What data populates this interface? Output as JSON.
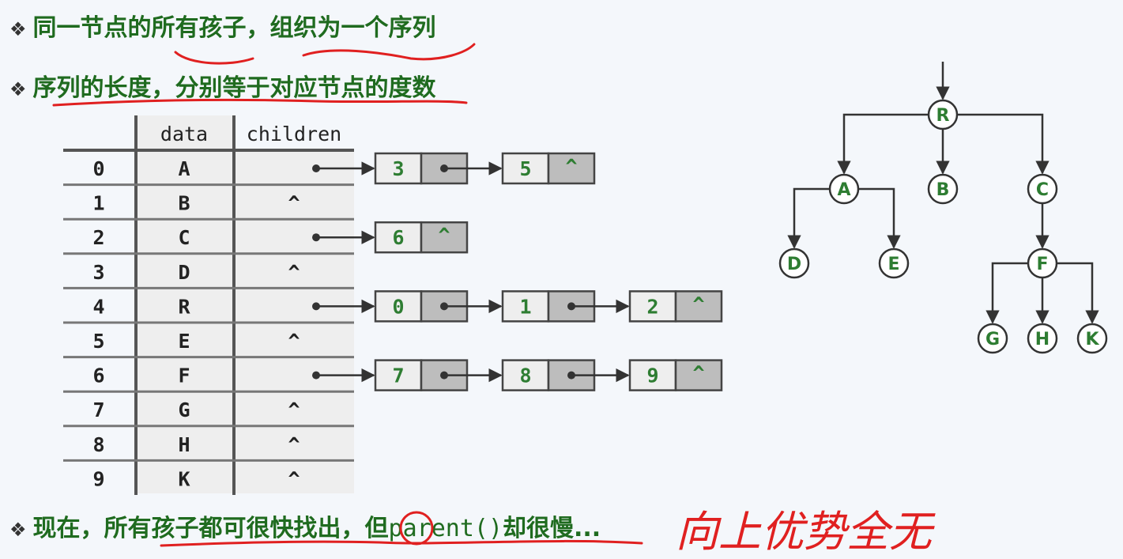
{
  "bullets": {
    "mark": "❖",
    "line1": "同一节点的所有孩子，组织为一个序列",
    "line2": "序列的长度，分别等于对应节点的度数",
    "line3_text": "现在，所有孩子都可很快找出，但",
    "line3_code": "parent()",
    "line3_tail": "却很慢..."
  },
  "table": {
    "headers": {
      "data": "data",
      "children": "children"
    },
    "rows": [
      {
        "index": "0",
        "data": "A",
        "children": []
      },
      {
        "index": "1",
        "data": "B",
        "children": "^"
      },
      {
        "index": "2",
        "data": "C",
        "children": []
      },
      {
        "index": "3",
        "data": "D",
        "children": "^"
      },
      {
        "index": "4",
        "data": "R",
        "children": []
      },
      {
        "index": "5",
        "data": "E",
        "children": "^"
      },
      {
        "index": "6",
        "data": "F",
        "children": []
      },
      {
        "index": "7",
        "data": "G",
        "children": "^"
      },
      {
        "index": "8",
        "data": "H",
        "children": "^"
      },
      {
        "index": "9",
        "data": "K",
        "children": "^"
      }
    ],
    "null_symbol": "^"
  },
  "child_lists": [
    {
      "row": "0",
      "values": [
        "3",
        "5"
      ]
    },
    {
      "row": "2",
      "values": [
        "6"
      ]
    },
    {
      "row": "4",
      "values": [
        "0",
        "1",
        "2"
      ]
    },
    {
      "row": "6",
      "values": [
        "7",
        "8",
        "9"
      ]
    }
  ],
  "tree": {
    "nodes": [
      "R",
      "A",
      "B",
      "C",
      "D",
      "E",
      "F",
      "G",
      "H",
      "K"
    ],
    "edges": [
      [
        "R",
        "A"
      ],
      [
        "R",
        "B"
      ],
      [
        "R",
        "C"
      ],
      [
        "A",
        "D"
      ],
      [
        "A",
        "E"
      ],
      [
        "C",
        "F"
      ],
      [
        "F",
        "G"
      ],
      [
        "F",
        "H"
      ],
      [
        "F",
        "K"
      ]
    ]
  },
  "handwritten_note": "向上优势全无",
  "colors": {
    "green": "#2e7d32",
    "red": "#e02020",
    "cell_light": "#eeeeee",
    "cell_dark": "#bdbdbd",
    "line": "#333333"
  }
}
